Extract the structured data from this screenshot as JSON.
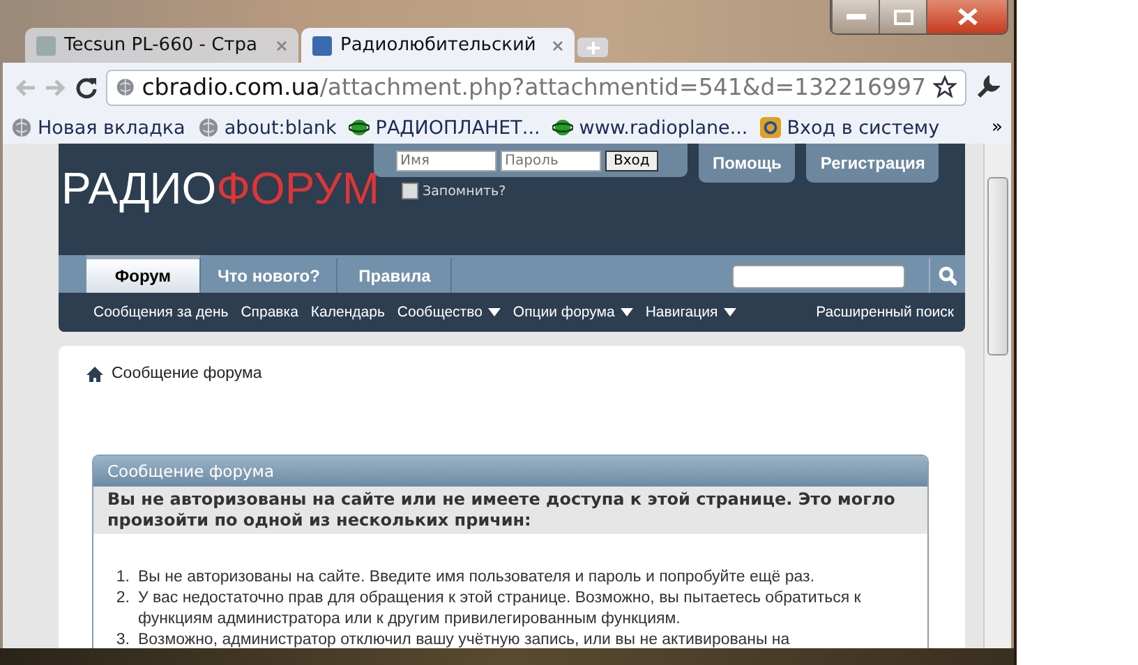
{
  "browser": {
    "tabs": [
      {
        "title": "Tecsun PL-660 - Стра",
        "selected": false
      },
      {
        "title": "Радиолюбительский",
        "selected": true
      }
    ],
    "address": {
      "host": "cbradio.com.ua",
      "path": "/attachment.php?attachmentid=541&d=132216997"
    },
    "bookmarks": [
      {
        "label": "Новая вкладка",
        "kind": "globe"
      },
      {
        "label": "about:blank",
        "kind": "globe"
      },
      {
        "label": "РАДИОПЛАНЕТ...",
        "kind": "planet"
      },
      {
        "label": "www.radioplane...",
        "kind": "planet"
      },
      {
        "label": "Вход в систему",
        "kind": "mail"
      }
    ],
    "bookmarks_more": "»"
  },
  "header": {
    "logo_first": "РАДИО",
    "logo_second": "ФОРУМ",
    "login": {
      "name_placeholder": "Имя",
      "password_placeholder": "Пароль",
      "submit": "Вход",
      "remember": "Запомнить?",
      "remember_checked": false
    },
    "buttons": [
      "Помощь",
      "Регистрация"
    ],
    "tabs": [
      {
        "label": "Форум",
        "selected": true
      },
      {
        "label": "Что нового?",
        "selected": false
      },
      {
        "label": "Правила",
        "selected": false
      }
    ],
    "subnav": [
      {
        "label": "Сообщения за день",
        "dropdown": false
      },
      {
        "label": "Справка",
        "dropdown": false
      },
      {
        "label": "Календарь",
        "dropdown": false
      },
      {
        "label": "Сообщество",
        "dropdown": true
      },
      {
        "label": "Опции форума",
        "dropdown": true
      },
      {
        "label": "Навигация",
        "dropdown": true
      }
    ],
    "advanced_search": "Расширенный поиск"
  },
  "breadcrumb": "Сообщение форума",
  "message": {
    "title": "Сообщение форума",
    "lead": "Вы не авторизованы на сайте или не имеете доступа к этой странице. Это могло произойти по одной из нескольких причин:",
    "reasons": [
      {
        "number": "1.",
        "text": "Вы не авторизованы на сайте. Введите имя пользователя и пароль и попробуйте ещё раз."
      },
      {
        "number": "2.",
        "text": "У вас недостаточно прав для обращения к этой странице. Возможно, вы пытаетесь обратиться к функциям администратора или к другим привилегированным функциям."
      },
      {
        "number": "3.",
        "text": "Возможно, администратор отключил вашу учётную запись, или вы не активированы на"
      }
    ]
  }
}
